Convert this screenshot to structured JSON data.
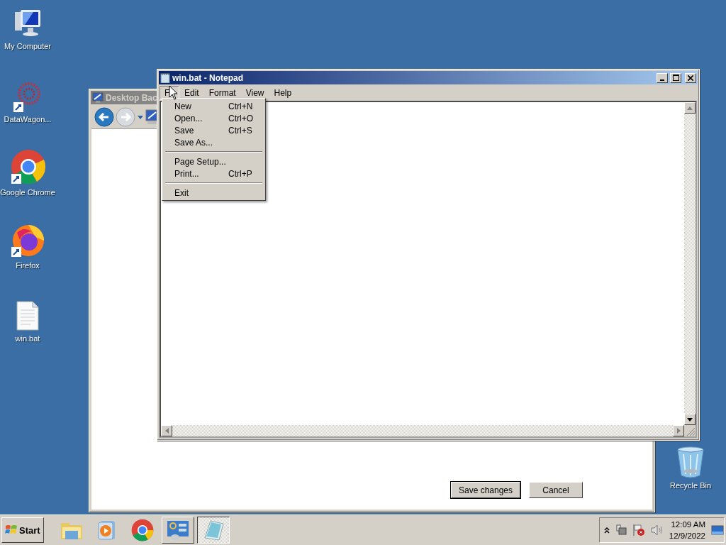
{
  "desktop_icons": [
    {
      "label": "My Computer",
      "kind": "computer"
    },
    {
      "label": "DataWagon...",
      "kind": "app"
    },
    {
      "label": "Google Chrome",
      "kind": "chrome"
    },
    {
      "label": "Firefox",
      "kind": "firefox"
    },
    {
      "label": "win.bat",
      "kind": "file"
    }
  ],
  "recycle_bin": {
    "label": "Recycle Bin",
    "kind": "recycle"
  },
  "background_window": {
    "title": "Desktop Bac",
    "active": false,
    "buttons": [
      {
        "label": "Save changes",
        "default": true
      },
      {
        "label": "Cancel",
        "default": false
      }
    ]
  },
  "notepad": {
    "title": "win.bat - Notepad",
    "active": true,
    "menu_bar": [
      {
        "label": "F",
        "selected": true
      },
      {
        "label": "Edit",
        "selected": false
      },
      {
        "label": "Format",
        "selected": false
      },
      {
        "label": "View",
        "selected": false
      },
      {
        "label": "Help",
        "selected": false
      }
    ],
    "file_menu": [
      {
        "kind": "item",
        "label": "New",
        "shortcut": "Ctrl+N"
      },
      {
        "kind": "item",
        "label": "Open...",
        "shortcut": "Ctrl+O"
      },
      {
        "kind": "item",
        "label": "Save",
        "shortcut": "Ctrl+S"
      },
      {
        "kind": "item",
        "label": "Save As..."
      },
      {
        "kind": "separator"
      },
      {
        "kind": "item",
        "label": "Page Setup..."
      },
      {
        "kind": "item",
        "label": "Print...",
        "shortcut": "Ctrl+P"
      },
      {
        "kind": "separator"
      },
      {
        "kind": "item",
        "label": "Exit"
      }
    ]
  },
  "taskbar": {
    "start": "Start",
    "apps": [
      {
        "kind": "explorer",
        "running": false,
        "selected": false
      },
      {
        "kind": "media",
        "running": false,
        "selected": false
      },
      {
        "kind": "chrome",
        "running": false,
        "selected": false
      },
      {
        "kind": "control",
        "running": true,
        "selected": false
      },
      {
        "kind": "notepad",
        "running": true,
        "selected": true
      }
    ],
    "clock": {
      "time": "12:09 AM",
      "date": "12/9/2022"
    }
  }
}
